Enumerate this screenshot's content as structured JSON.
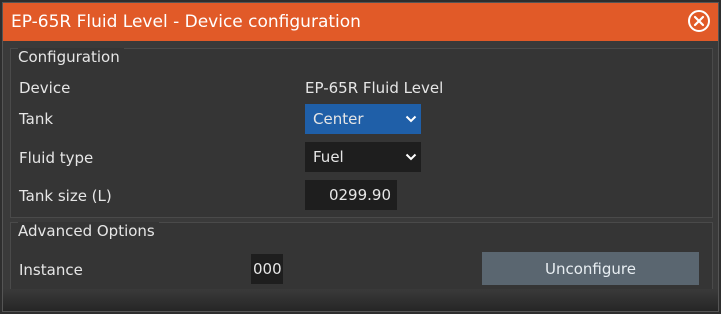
{
  "window": {
    "title": "EP-65R Fluid Level - Device configuration",
    "close_icon": "close-circle-icon"
  },
  "configuration": {
    "group_title": "Configuration",
    "device_label": "Device",
    "device_value": "EP-65R Fluid Level",
    "tank_label": "Tank",
    "tank_value": "Center",
    "fluid_type_label": "Fluid type",
    "fluid_type_value": "Fuel",
    "tank_size_label": "Tank size (L)",
    "tank_size_value": "0299.90"
  },
  "advanced": {
    "group_title": "Advanced Options",
    "instance_label": "Instance",
    "instance_value": "000",
    "unconfigure_label": "Unconfigure"
  },
  "colors": {
    "title_bar": "#e15a28",
    "selected_field": "#1f5fa8",
    "button": "#5a6670"
  }
}
